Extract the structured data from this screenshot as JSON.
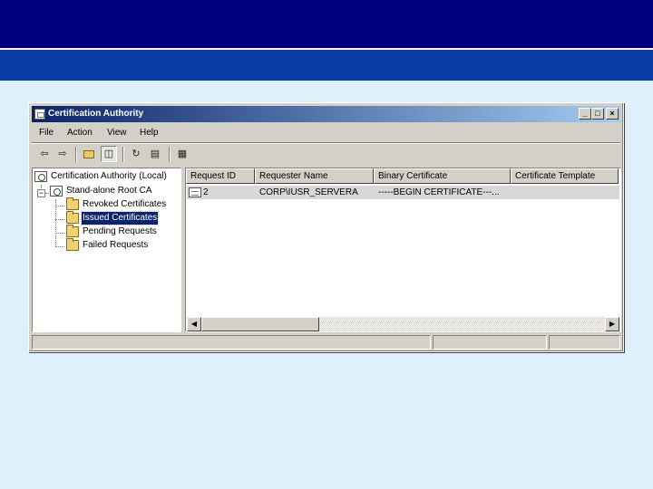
{
  "window": {
    "title": "Certification Authority",
    "controls": {
      "minimize": "_",
      "maximize": "□",
      "close": "×"
    }
  },
  "menu": [
    "File",
    "Action",
    "View",
    "Help"
  ],
  "toolbar_icons": [
    "back-icon",
    "forward-icon",
    "up-folder-icon",
    "show-hide-tree-icon",
    "refresh-icon",
    "export-list-icon",
    "properties-icon"
  ],
  "tree": {
    "root": "Certification Authority (Local)",
    "ca": "Stand-alone Root CA",
    "folders": [
      "Revoked Certificates",
      "Issued Certificates",
      "Pending Requests",
      "Failed Requests"
    ],
    "selected": "Issued Certificates"
  },
  "list": {
    "columns": [
      "Request ID",
      "Requester Name",
      "Binary Certificate",
      "Certificate Template"
    ],
    "rows": [
      {
        "request_id": "2",
        "requester_name": "CORP\\IUSR_SERVERA",
        "binary_certificate": "-----BEGIN CERTIFICATE---...",
        "certificate_template": ""
      }
    ]
  },
  "colors": {
    "header_band": "#000080",
    "sub_band": "#0a3ea6",
    "background": "#dff0fd",
    "selection": "#0a246a"
  }
}
